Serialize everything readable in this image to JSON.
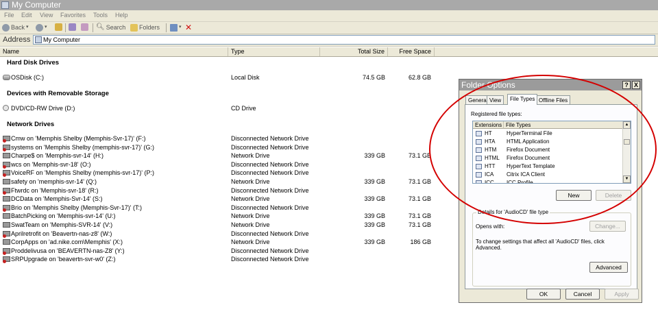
{
  "window": {
    "title": "My Computer"
  },
  "menu": [
    "File",
    "Edit",
    "View",
    "Favorites",
    "Tools",
    "Help"
  ],
  "toolbar": {
    "back": "Back",
    "search": "Search",
    "folders": "Folders"
  },
  "address": {
    "label": "Address",
    "value": "My Computer"
  },
  "columns": {
    "name": "Name",
    "type": "Type",
    "total": "Total Size",
    "free": "Free Space"
  },
  "groups": {
    "hdd": "Hard Disk Drives",
    "removable": "Devices with Removable Storage",
    "network": "Network Drives"
  },
  "rows": {
    "hdd": [
      {
        "name": "OSDisk (C:)",
        "type": "Local Disk",
        "total": "74.5 GB",
        "free": "62.8 GB"
      }
    ],
    "removable": [
      {
        "name": "DVD/CD-RW Drive (D:)",
        "type": "CD Drive",
        "total": "",
        "free": ""
      }
    ],
    "network": [
      {
        "name": "Cmw on 'Memphis Shelby (Memphis-Svr-17)' (F:)",
        "type": "Disconnected Network Drive",
        "total": "",
        "free": ""
      },
      {
        "name": "systems on 'Memphis Shelby (memphis-svr-17)' (G:)",
        "type": "Disconnected Network Drive",
        "total": "",
        "free": ""
      },
      {
        "name": "Charpe$ on 'Memphis-svr-14' (H:)",
        "type": "Network Drive",
        "total": "339 GB",
        "free": "73.1 GB"
      },
      {
        "name": "wcs on 'Memphis-svr-18' (O:)",
        "type": "Disconnected Network Drive",
        "total": "",
        "free": ""
      },
      {
        "name": "VoiceRF on 'Memphis Shelby (memphis-svr-17)' (P:)",
        "type": "Disconnected Network Drive",
        "total": "",
        "free": ""
      },
      {
        "name": "safety on 'memphis-svr-14' (Q:)",
        "type": "Network Drive",
        "total": "339 GB",
        "free": "73.1 GB"
      },
      {
        "name": "Ftwrdc on 'Memphis-svr-18' (R:)",
        "type": "Disconnected Network Drive",
        "total": "",
        "free": ""
      },
      {
        "name": "DCData on 'Memphis-Svr-14' (S:)",
        "type": "Network Drive",
        "total": "339 GB",
        "free": "73.1 GB"
      },
      {
        "name": "Brio on 'Memphis Shelby (Memphis-Svr-17)' (T:)",
        "type": "Disconnected Network Drive",
        "total": "",
        "free": ""
      },
      {
        "name": "BatchPicking on 'Memphis-svr-14' (U:)",
        "type": "Network Drive",
        "total": "339 GB",
        "free": "73.1 GB"
      },
      {
        "name": "SwatTeam on 'Memphis-SVR-14' (V:)",
        "type": "Network Drive",
        "total": "339 GB",
        "free": "73.1 GB"
      },
      {
        "name": "Aprilretrofit on 'Beavertn-nas-z8' (W:)",
        "type": "Disconnected Network Drive",
        "total": "",
        "free": ""
      },
      {
        "name": "CorpApps on 'ad.nike.com\\Memphis' (X:)",
        "type": "Network Drive",
        "total": "339 GB",
        "free": "186 GB"
      },
      {
        "name": "Proddelivusa on 'BEAVERTN-nas-Z8' (Y:)",
        "type": "Disconnected Network Drive",
        "total": "",
        "free": ""
      },
      {
        "name": "SRPUpgrade on 'beavertn-svr-w0' (Z:)",
        "type": "Disconnected Network Drive",
        "total": "",
        "free": ""
      }
    ]
  },
  "dialog": {
    "title": "Folder Options",
    "help_btn": "?",
    "close_btn": "X",
    "tabs": [
      "General",
      "View",
      "File Types",
      "Offline Files"
    ],
    "registered_label": "Registered file types:",
    "list_headers": {
      "ext": "Extensions",
      "type": "File Types"
    },
    "file_types": [
      {
        "ext": "HT",
        "type": "HyperTerminal File"
      },
      {
        "ext": "HTA",
        "type": "HTML Application"
      },
      {
        "ext": "HTM",
        "type": "Firefox Document"
      },
      {
        "ext": "HTML",
        "type": "Firefox Document"
      },
      {
        "ext": "HTT",
        "type": "HyperText Template"
      },
      {
        "ext": "ICA",
        "type": "Citrix ICA Client"
      },
      {
        "ext": "ICC",
        "type": "ICC Profile"
      }
    ],
    "new_btn": "New",
    "delete_btn": "Delete",
    "details_legend": "Details for 'AudioCD' file type",
    "opens_with": "Opens with:",
    "change_btn": "Change...",
    "details_text": "To change settings that affect all 'AudioCD' files, click Advanced.",
    "advanced_btn": "Advanced",
    "ok_btn": "OK",
    "cancel_btn": "Cancel",
    "apply_btn": "Apply"
  }
}
